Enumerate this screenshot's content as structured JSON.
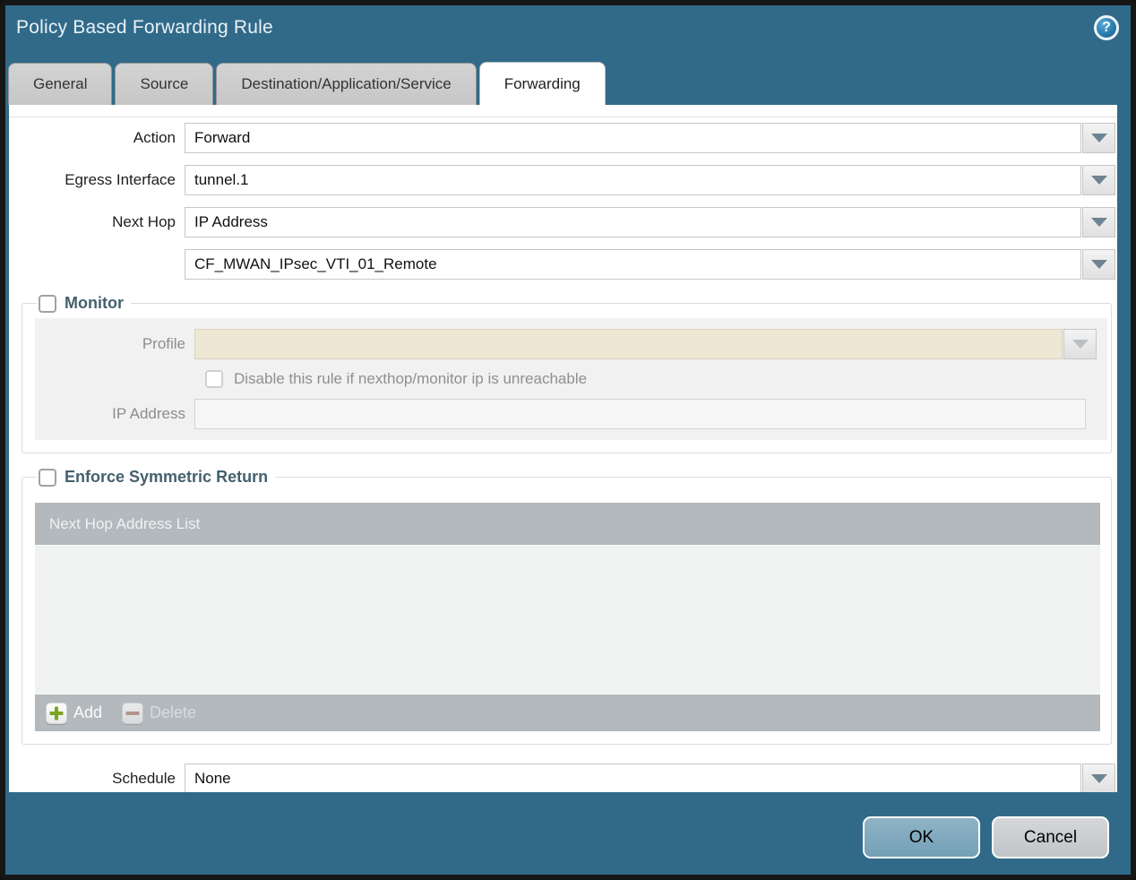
{
  "dialog": {
    "title": "Policy Based Forwarding Rule",
    "help_glyph": "?"
  },
  "tabs": [
    {
      "label": "General",
      "active": false
    },
    {
      "label": "Source",
      "active": false
    },
    {
      "label": "Destination/Application/Service",
      "active": false
    },
    {
      "label": "Forwarding",
      "active": true
    }
  ],
  "form": {
    "action": {
      "label": "Action",
      "value": "Forward"
    },
    "egress_interface": {
      "label": "Egress Interface",
      "value": "tunnel.1"
    },
    "next_hop": {
      "label": "Next Hop",
      "value": "IP Address"
    },
    "next_hop_address": {
      "value": "CF_MWAN_IPsec_VTI_01_Remote"
    },
    "schedule": {
      "label": "Schedule",
      "value": "None"
    }
  },
  "monitor": {
    "legend": "Monitor",
    "checked": false,
    "profile": {
      "label": "Profile",
      "value": ""
    },
    "disable_rule_label": "Disable this rule if nexthop/monitor ip is unreachable",
    "disable_rule_checked": false,
    "ip_address": {
      "label": "IP Address",
      "value": ""
    }
  },
  "symmetric_return": {
    "legend": "Enforce Symmetric Return",
    "checked": false,
    "table": {
      "header": "Next Hop Address List",
      "rows": []
    },
    "add_label": "Add",
    "delete_label": "Delete",
    "delete_enabled": false
  },
  "footer": {
    "ok_label": "OK",
    "cancel_label": "Cancel"
  },
  "colors": {
    "chrome_teal": "#316a89",
    "tab_inactive_gray": "#c9c9c9",
    "table_chrome_gray": "#b3b9bd",
    "table_body_gray": "#f0f1f1",
    "disabled_field_beige": "#ede7d3",
    "legend_slate": "#44606e",
    "ok_button_blue": "#7fa9bd",
    "cancel_button_gray": "#c9cccf",
    "add_plus_green": "#7da521",
    "delete_minus_red": "#b5837b"
  }
}
